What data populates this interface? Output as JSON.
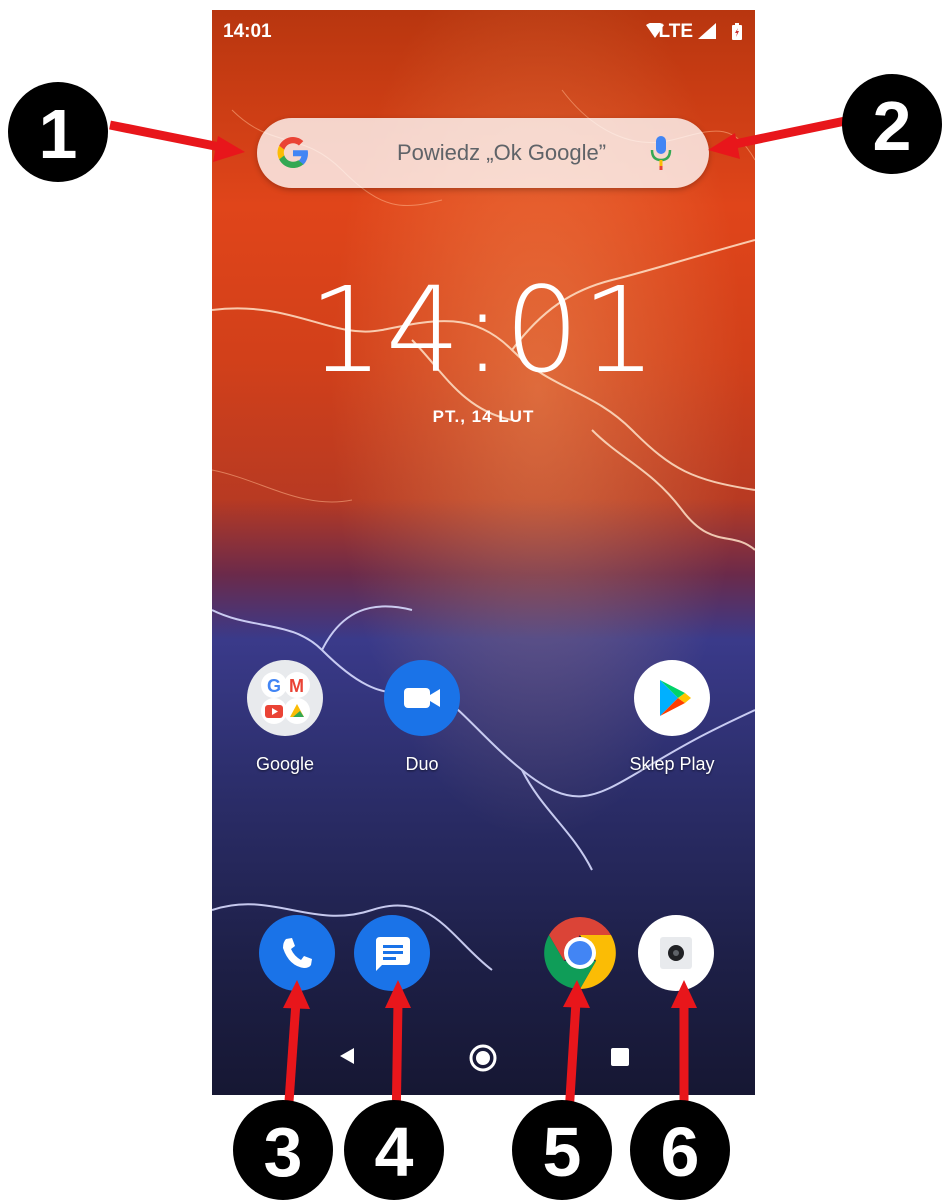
{
  "status_bar": {
    "time": "14:01",
    "network": "LTE"
  },
  "search": {
    "hint": "Powiedz „Ok Google”"
  },
  "clock": {
    "time": "14:01",
    "date": "PT., 14 LUT"
  },
  "home_apps": [
    {
      "label": "Google",
      "icon": "google-folder-icon"
    },
    {
      "label": "Duo",
      "icon": "duo-video-icon"
    },
    {
      "label": "Sklep Play",
      "icon": "play-store-icon"
    }
  ],
  "dock": [
    {
      "icon": "phone-icon"
    },
    {
      "icon": "messages-icon"
    },
    {
      "icon": "chrome-icon"
    },
    {
      "icon": "camera-icon"
    }
  ],
  "callouts": [
    "1",
    "2",
    "3",
    "4",
    "5",
    "6"
  ],
  "colors": {
    "callout_arrow": "#e8161b",
    "callout_badge": "#000000",
    "app_blue": "#1a73e8"
  }
}
